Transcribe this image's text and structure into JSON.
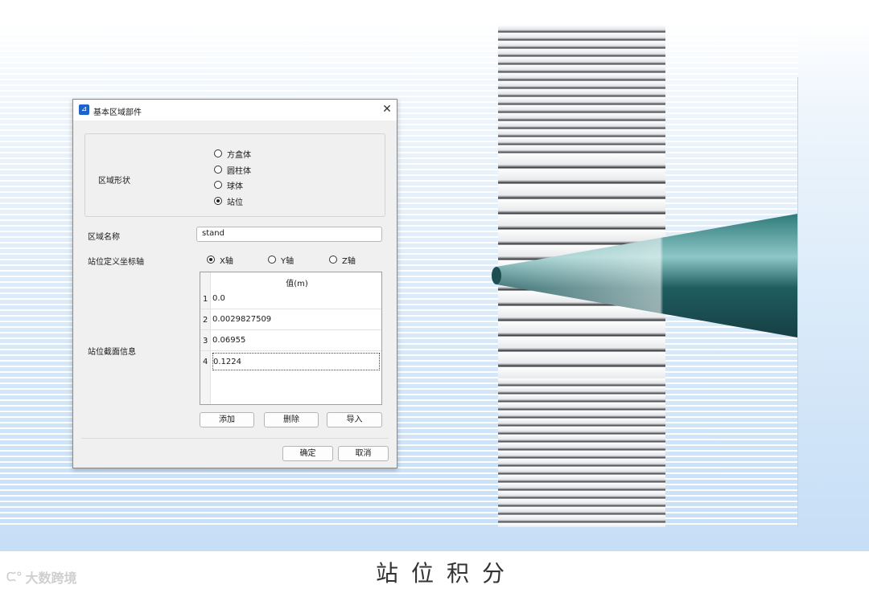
{
  "dialog": {
    "title": "基本区域部件",
    "close_glyph": "✕",
    "shape_label": "区域形状",
    "shape_options": [
      {
        "label": "方盒体",
        "checked": false
      },
      {
        "label": "圆柱体",
        "checked": false
      },
      {
        "label": "球体",
        "checked": false
      },
      {
        "label": "站位",
        "checked": true
      }
    ],
    "name_label": "区域名称",
    "name_value": "stand",
    "axis_label": "站位定义坐标轴",
    "axis_options": [
      {
        "label": "X轴",
        "checked": true
      },
      {
        "label": "Y轴",
        "checked": false
      },
      {
        "label": "Z轴",
        "checked": false
      }
    ],
    "section_label": "站位截面信息",
    "table": {
      "header": "值(m)",
      "rows": [
        {
          "index": "1",
          "value": "0.0"
        },
        {
          "index": "2",
          "value": "0.0029827509"
        },
        {
          "index": "3",
          "value": "0.06955"
        },
        {
          "index": "4",
          "value": "0.1224"
        }
      ],
      "selected_row": 4
    },
    "buttons": {
      "add": "添加",
      "delete": "删除",
      "import": "导入",
      "ok": "确定",
      "cancel": "取消"
    }
  },
  "footer": {
    "logo_text": "大数跨境",
    "caption": "站位积分"
  },
  "colors": {
    "viewport_bg": "#d8e9f9",
    "cone_dark": "#1f5d60",
    "cone_light": "#8fc3c3",
    "dialog_bg": "#f0f0f0",
    "app_icon": "#1e63c9"
  },
  "icons": {
    "app": "app-logo-icon",
    "close": "close-icon",
    "footer": "brand-logo-icon"
  }
}
